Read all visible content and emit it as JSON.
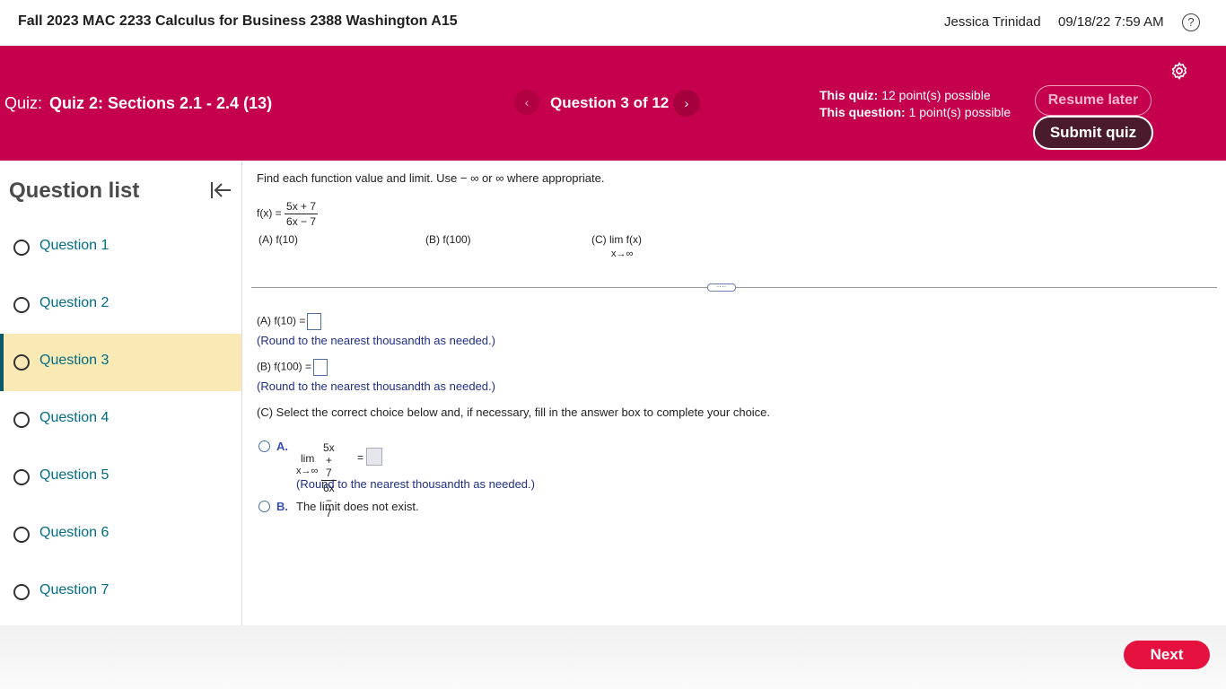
{
  "topbar": {
    "course_title": "Fall 2023 MAC 2233 Calculus for Business 2388 Washington A15",
    "user_name": "Jessica Trinidad",
    "datetime": "09/18/22 7:59 AM",
    "help_icon": "?"
  },
  "quiz_header": {
    "quiz_label": "Quiz:",
    "quiz_name": "Quiz 2: Sections 2.1 - 2.4 (13)",
    "prev_icon": "‹",
    "question_counter": "Question 3 of 12",
    "next_icon": "›",
    "quiz_points_label": "This quiz:",
    "quiz_points_value": "12 point(s) possible",
    "question_points_label": "This question:",
    "question_points_value": "1 point(s) possible",
    "resume_label": "Resume later",
    "submit_label": "Submit quiz",
    "header_color": "#c5004c"
  },
  "sidebar": {
    "title": "Question list",
    "items": [
      {
        "label": "Question 1"
      },
      {
        "label": "Question 2"
      },
      {
        "label": "Question 3",
        "active": true
      },
      {
        "label": "Question 4"
      },
      {
        "label": "Question 5"
      },
      {
        "label": "Question 6"
      },
      {
        "label": "Question 7"
      }
    ]
  },
  "question": {
    "prompt": "Find each function value and limit. Use − ∞ or ∞ where appropriate.",
    "fx_lhs": "f(x) =",
    "fx_num": "5x + 7",
    "fx_den": "6x − 7",
    "part_a": "(A) f(10)",
    "part_b": "(B) f(100)",
    "part_c": "(C)  lim  f(x)",
    "part_c_sub": "x→∞",
    "divider_handle": "····"
  },
  "answers": {
    "a_label": "(A) f(10) =",
    "a_hint": "(Round to the nearest thousandth as needed.)",
    "b_label": "(B) f(100) =",
    "b_hint": "(Round to the nearest thousandth as needed.)",
    "c_instruction": "(C) Select the correct choice below and, if necessary, fill in the answer box to complete your choice.",
    "choice_a_letter": "A.",
    "choice_a_lim": "lim",
    "choice_a_sub": "x→∞",
    "choice_a_num": "5x + 7",
    "choice_a_den": "6x − 7",
    "choice_a_eq": "=",
    "choice_a_hint": "(Round to the nearest thousandth as needed.)",
    "choice_b_letter": "B.",
    "choice_b_text": "The limit does not exist."
  },
  "footer": {
    "next_label": "Next",
    "next_color": "#e5123f"
  }
}
